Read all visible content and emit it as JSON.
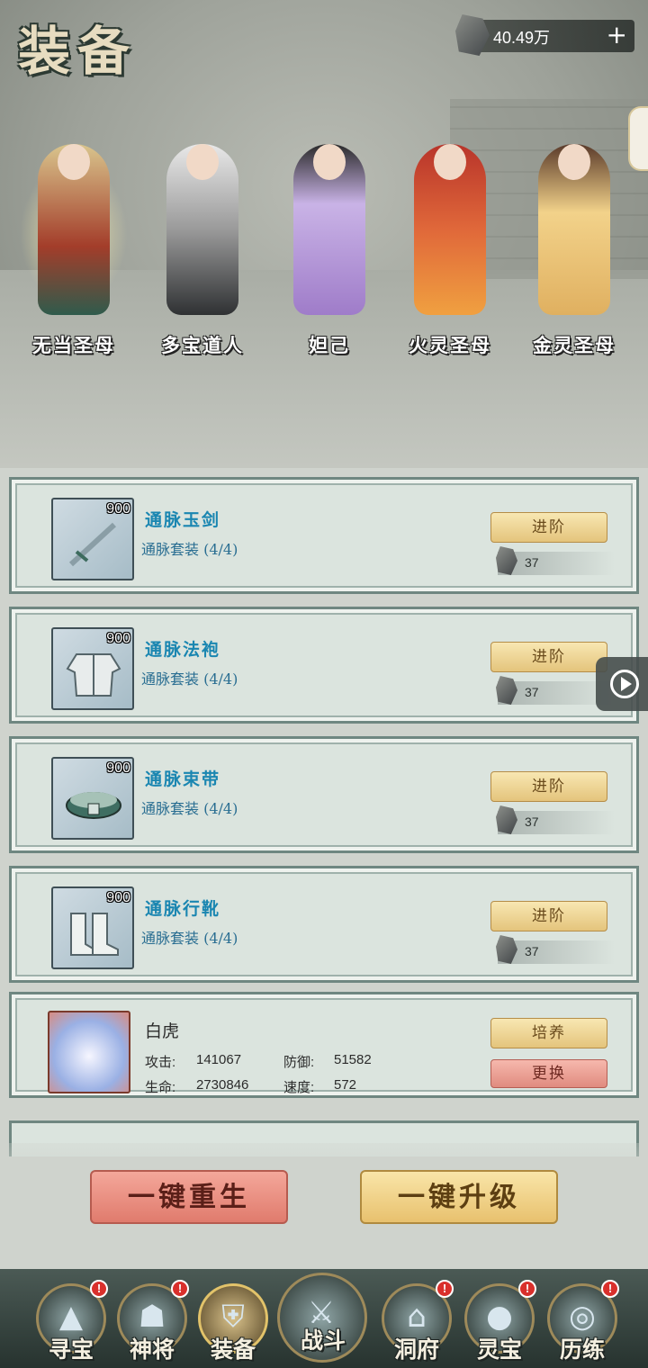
{
  "header": {
    "title": "装备",
    "currency_amount": "40.49万",
    "add_icon": "plus-icon",
    "currency_icon": "ore-icon"
  },
  "heroes": [
    {
      "name": "无当圣母",
      "selected": true
    },
    {
      "name": "多宝道人",
      "selected": false
    },
    {
      "name": "妲己",
      "selected": false
    },
    {
      "name": "火灵圣母",
      "selected": false
    },
    {
      "name": "金灵圣母",
      "selected": false
    }
  ],
  "equipment": [
    {
      "level": "900",
      "name": "通脉玉剑",
      "set": "通脉套装 (4/4)",
      "button": "进阶",
      "cost": "37",
      "icon": "sword-icon"
    },
    {
      "level": "900",
      "name": "通脉法袍",
      "set": "通脉套装 (4/4)",
      "button": "进阶",
      "cost": "37",
      "icon": "robe-icon"
    },
    {
      "level": "900",
      "name": "通脉束带",
      "set": "通脉套装 (4/4)",
      "button": "进阶",
      "cost": "37",
      "icon": "belt-icon"
    },
    {
      "level": "900",
      "name": "通脉行靴",
      "set": "通脉套装 (4/4)",
      "button": "进阶",
      "cost": "37",
      "icon": "boots-icon"
    }
  ],
  "beast": {
    "name": "白虎",
    "attack_label": "攻击:",
    "attack": "141067",
    "defense_label": "防御:",
    "defense": "51582",
    "hp_label": "生命:",
    "hp": "2730846",
    "speed_label": "速度:",
    "speed": "572",
    "train_button": "培养",
    "swap_button": "更换"
  },
  "actions": {
    "rebirth": "一键重生",
    "upgrade": "一键升级"
  },
  "nav": [
    {
      "label": "寻宝",
      "icon": "mountain-icon",
      "badge": "!",
      "active": false
    },
    {
      "label": "神将",
      "icon": "general-icon",
      "badge": "!",
      "active": false
    },
    {
      "label": "装备",
      "icon": "armor-icon",
      "badge": "",
      "active": true
    },
    {
      "label": "战斗",
      "icon": "battle-icon",
      "badge": "",
      "active": false
    },
    {
      "label": "洞府",
      "icon": "palace-icon",
      "badge": "!",
      "active": false
    },
    {
      "label": "灵宝",
      "icon": "gourd-icon",
      "badge": "!",
      "active": false
    },
    {
      "label": "历练",
      "icon": "portal-icon",
      "badge": "!",
      "active": false
    }
  ],
  "colors": {
    "accent_gold": "#e4c47c",
    "accent_red": "#e08b7f",
    "equip_name": "#1a86b1",
    "card_bg": "#dbe4de"
  }
}
